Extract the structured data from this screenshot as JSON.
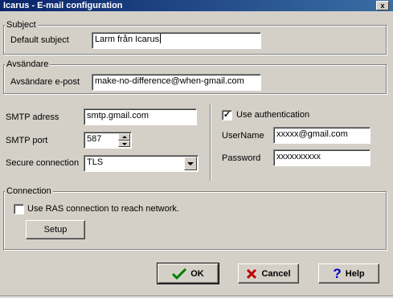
{
  "window": {
    "title": "Icarus - E-mail configuration",
    "close_glyph": "x"
  },
  "subject": {
    "group_label": "Subject",
    "default_subject_label": "Default subject",
    "default_subject_value": "Larm från Icarus"
  },
  "sender": {
    "group_label": "Avsändare",
    "email_label": "Avsändare e-post",
    "email_value": "make-no-difference@when-gmail.com"
  },
  "smtp": {
    "address_label": "SMTP adress",
    "address_value": "smtp.gmail.com",
    "port_label": "SMTP port",
    "port_value": "587",
    "secure_label": "Secure connection",
    "secure_value": "TLS"
  },
  "auth": {
    "use_auth_label": "Use authentication",
    "use_auth_checked": true,
    "username_label": "UserName",
    "username_value": "xxxxx@gmail.com",
    "password_label": "Password",
    "password_value": "xxxxxxxxxx"
  },
  "connection": {
    "group_label": "Connection",
    "ras_label": "Use RAS connection to reach network.",
    "ras_checked": false,
    "setup_label": "Setup"
  },
  "buttons": {
    "ok_label": "OK",
    "cancel_label": "Cancel",
    "help_label": "Help"
  },
  "icons": {
    "ok_icon": "check-icon",
    "cancel_icon": "x-icon",
    "help_icon": "question-icon"
  },
  "colors": {
    "title_bar": "#0a246a",
    "face": "#d4d0c8",
    "ok_icon": "#008000",
    "cancel_icon": "#c00000",
    "help_icon": "#0000c0"
  }
}
